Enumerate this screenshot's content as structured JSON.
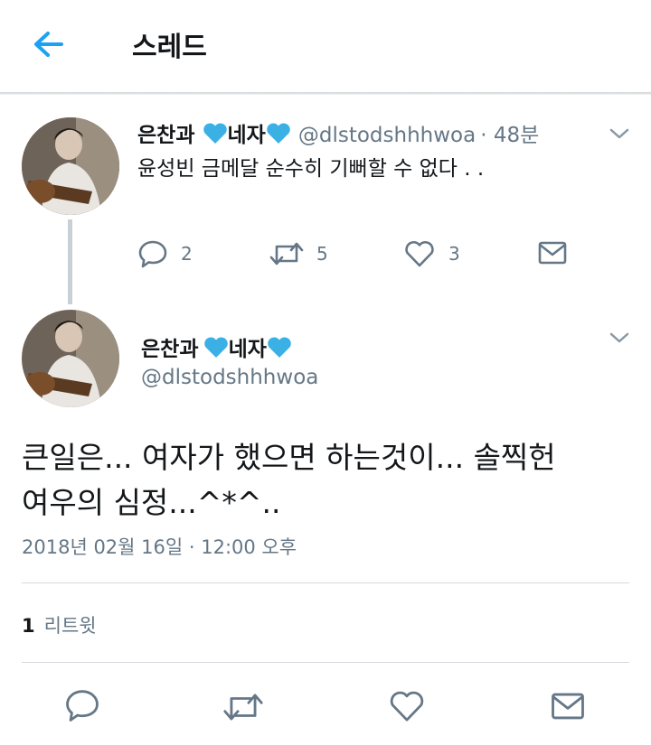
{
  "header": {
    "title": "스레드",
    "back_icon": "arrow-left-icon",
    "accent": "#1da1f2"
  },
  "tweet1": {
    "name_part1": "은찬과",
    "name_part2": "네자",
    "handle": "@dlstodshhhwoa",
    "time": "· 48분",
    "text": "윤성빈 금메달 순수히 기뻐할 수 없다 . .",
    "actions": {
      "reply_count": "2",
      "retweet_count": "5",
      "like_count": "3"
    }
  },
  "tweet2": {
    "name_part1": "은찬과",
    "name_part2": "네자",
    "handle": "@dlstodshhhwoa",
    "text_line1": "큰일은... 여자가 했으면 하는것이... 솔찍헌",
    "text_line2": "여우의 심정...^*^..",
    "timestamp": "2018년 02월 16일 · 12:00 오후",
    "retweet_count": "1",
    "retweet_label": "리트윗"
  },
  "colors": {
    "heart": "#3ab0e5",
    "icon_gray": "#657786",
    "text": "#14171a"
  }
}
